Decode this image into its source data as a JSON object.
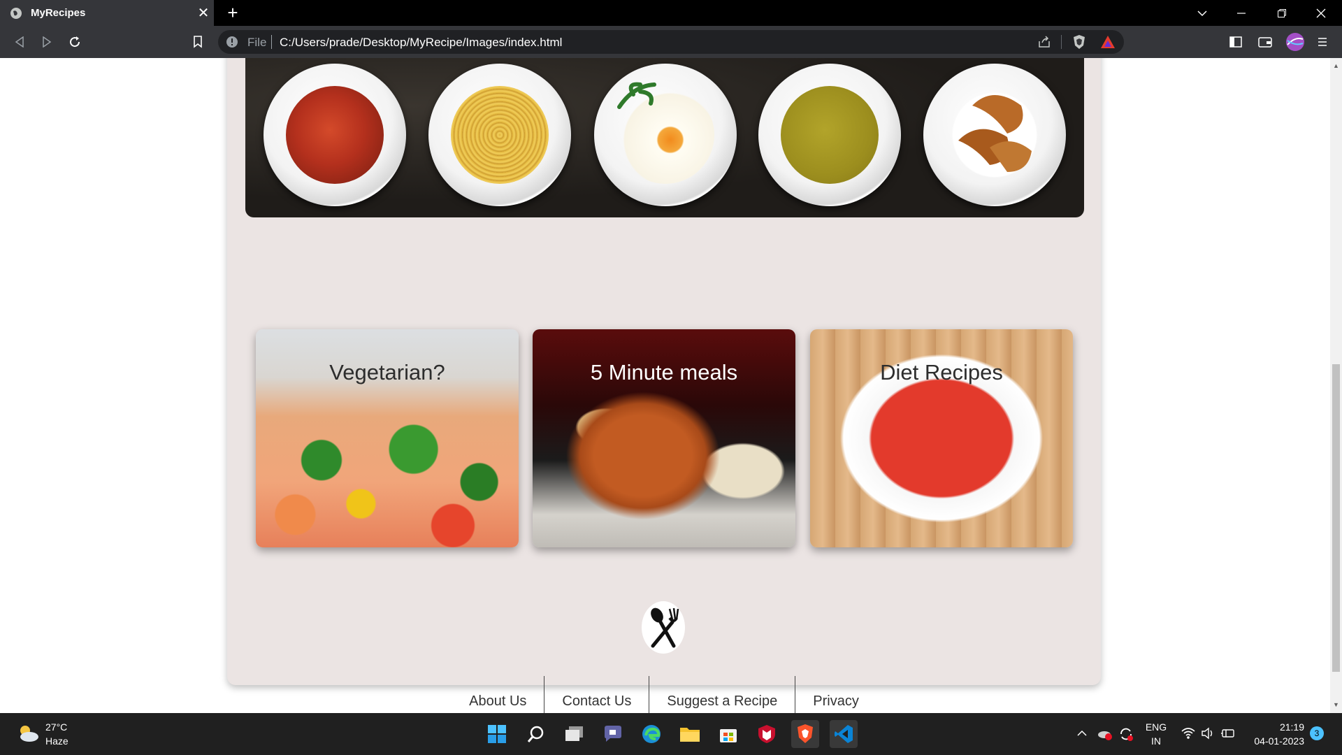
{
  "browser": {
    "tab_title": "MyRecipes",
    "omnibox_scheme": "File",
    "omnibox_url": "C:/Users/prade/Desktop/MyRecipe/Images/index.html"
  },
  "page": {
    "cards": [
      {
        "title": "Vegetarian?"
      },
      {
        "title": "5 Minute meals"
      },
      {
        "title": "Diet Recipes"
      }
    ],
    "footer_links": [
      "About Us",
      "Contact Us",
      "Suggest a Recipe",
      "Privacy"
    ]
  },
  "taskbar": {
    "weather_temp": "27°C",
    "weather_condition": "Haze",
    "language": "ENG",
    "region": "IN",
    "time": "21:19",
    "date": "04-01-2023",
    "notification_count": "3"
  },
  "colors": {
    "page_card": "#ebe4e3",
    "browser_chrome": "#35363a",
    "taskbar": "#202020"
  }
}
